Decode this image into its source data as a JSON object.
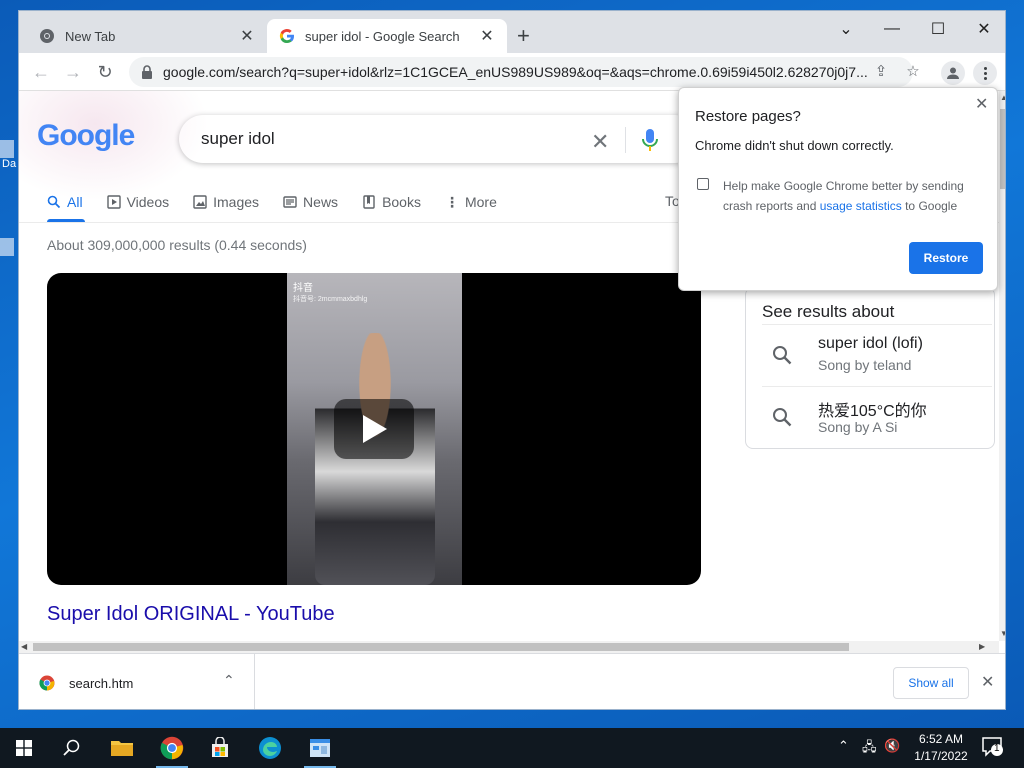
{
  "desktop": {
    "partial_label": "Da"
  },
  "tabs": [
    {
      "title": "New Tab",
      "close": "✕"
    },
    {
      "title": "super idol - Google Search",
      "close": "✕"
    }
  ],
  "new_tab_label": "+",
  "window_controls": {
    "minimize": "—",
    "maximize": "☐",
    "close": "✕",
    "tab_search": "⌄"
  },
  "address_bar": {
    "url": "google.com/search?q=super+idol&rlz=1C1GCEA_enUS989US989&oq=&aqs=chrome.0.69i59i450l2.628270j0j7..."
  },
  "search": {
    "logo_text": "Google",
    "query": "super idol",
    "clear": "✕",
    "tabs": [
      {
        "label": "All",
        "icon": "search-icon"
      },
      {
        "label": "Videos",
        "icon": "play-icon"
      },
      {
        "label": "Images",
        "icon": "image-icon"
      },
      {
        "label": "News",
        "icon": "newspaper-icon"
      },
      {
        "label": "Books",
        "icon": "book-icon"
      },
      {
        "label": "More",
        "icon": "more-vert-icon"
      }
    ],
    "tools_truncated": "To",
    "result_stats": "About 309,000,000 results (0.44 seconds)",
    "video_overlay": {
      "brand": "抖音",
      "id": "抖音号: 2mcmmaxbdhlg"
    },
    "top_result_title": "Super Idol ORIGINAL - YouTube"
  },
  "knowledge_panel": {
    "heading": "See results about",
    "items": [
      {
        "name": "super idol (lofi)",
        "sub": "Song by teland"
      },
      {
        "name": "热爱105°C的你",
        "sub": "Song by A Si"
      }
    ]
  },
  "restore_popup": {
    "title": "Restore pages?",
    "message": "Chrome didn't shut down correctly.",
    "checkbox_text": "Help make Google Chrome better by sending crash reports and ",
    "link_text": "usage statistics",
    "checkbox_text_end": " to Google",
    "button": "Restore",
    "close": "✕"
  },
  "download_bar": {
    "file": "search.htm",
    "chevron": "⌃",
    "show_all": "Show all",
    "close": "✕"
  },
  "taskbar": {
    "time": "6:52 AM",
    "date": "1/17/2022",
    "notification_count": "1"
  },
  "colors": {
    "accent": "#1a73e8",
    "link": "#1a0dab",
    "desktop": "#0b63c4"
  }
}
